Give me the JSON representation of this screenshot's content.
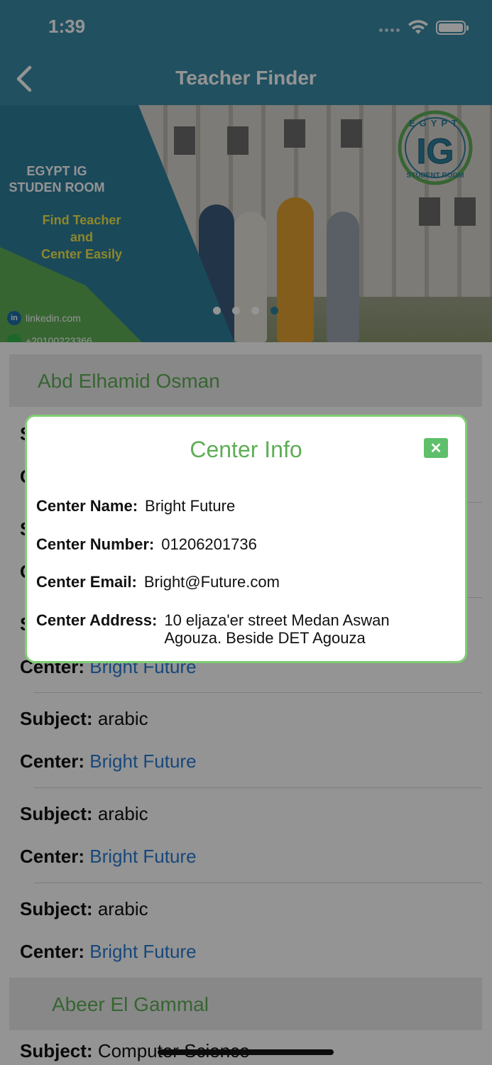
{
  "status": {
    "time": "1:39"
  },
  "nav": {
    "title": "Teacher Finder"
  },
  "banner": {
    "title_line1": "EGYPT IG",
    "title_line2": "STUDEN ROOM",
    "sub_line1": "Find Teacher",
    "sub_line2": "and",
    "sub_line3": "Center Easily",
    "linkedin": "linkedin.com",
    "phone": "+20100223366",
    "logo_top": "EGYPT",
    "logo_main": "IG",
    "logo_bottom": "STUDENT ROOM",
    "carousel_pages": 4,
    "carousel_active": 4
  },
  "list": {
    "teacher1": {
      "name": "Abd Elhamid Osman",
      "hidden_rows": [
        {
          "label": "S",
          "value": ""
        },
        {
          "label": "C",
          "value": ""
        },
        {
          "label": "S",
          "value": ""
        },
        {
          "label": "C",
          "value": ""
        },
        {
          "label": "S",
          "value": ""
        }
      ],
      "entries": [
        {
          "center_label": "Center:",
          "center_value": "Bright Future"
        },
        {
          "subject_label": "Subject:",
          "subject_value": "arabic",
          "center_label": "Center:",
          "center_value": "Bright Future"
        },
        {
          "subject_label": "Subject:",
          "subject_value": "arabic",
          "center_label": "Center:",
          "center_value": "Bright Future"
        },
        {
          "subject_label": "Subject:",
          "subject_value": "arabic",
          "center_label": "Center:",
          "center_value": "Bright Future"
        }
      ]
    },
    "teacher2": {
      "name": "Abeer El Gammal",
      "subject_label": "Subject:",
      "subject_value": "Computer Science"
    }
  },
  "modal": {
    "title": "Center Info",
    "close_glyph": "✕",
    "name_label": "Center Name:",
    "name_value": "Bright Future",
    "number_label": "Center Number:",
    "number_value": "01206201736",
    "email_label": "Center Email:",
    "email_value": "Bright@Future.com",
    "address_label": "Center Address:",
    "address_value": "10 eljaza'er street Medan Aswan Agouza. Beside DET Agouza"
  },
  "colors": {
    "nav_bg": "#3a8ba6",
    "accent_green": "#5fae57",
    "link_blue": "#2a7bd4",
    "modal_border": "#7fcf72"
  }
}
